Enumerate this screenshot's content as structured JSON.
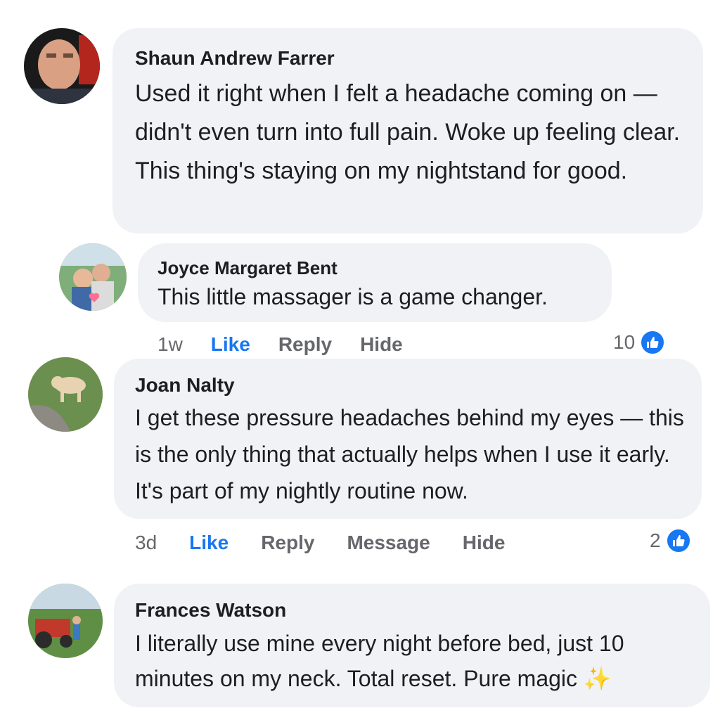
{
  "comments": [
    {
      "author": "Shaun Andrew Farrer",
      "text": "Used it right when I felt a headache coming on — didn't even turn into full pain. Woke up feeling clear. This thing's staying on my nightstand for good."
    },
    {
      "author": "Joyce Margaret Bent",
      "text": "This little massager is a game changer.",
      "time": "1w",
      "actions": [
        "Like",
        "Reply",
        "Hide"
      ],
      "reactions": "10"
    },
    {
      "author": "Joan Nalty",
      "text": "I get these pressure headaches behind my eyes — this is the only thing that actually helps when I use it early. It's part of my nightly routine now.",
      "time": "3d",
      "actions": [
        "Like",
        "Reply",
        "Message",
        "Hide"
      ],
      "reactions": "2"
    },
    {
      "author": "Frances Watson",
      "text": "I literally use mine every night before bed, just 10 minutes on my neck. Total reset. Pure magic ✨"
    }
  ],
  "colors": {
    "bubble": "#f0f2f5",
    "like_blue": "#1877f2",
    "meta_gray": "#65676b"
  },
  "icons": [
    "avatar",
    "thumbs-up-icon",
    "sparkles-emoji"
  ]
}
